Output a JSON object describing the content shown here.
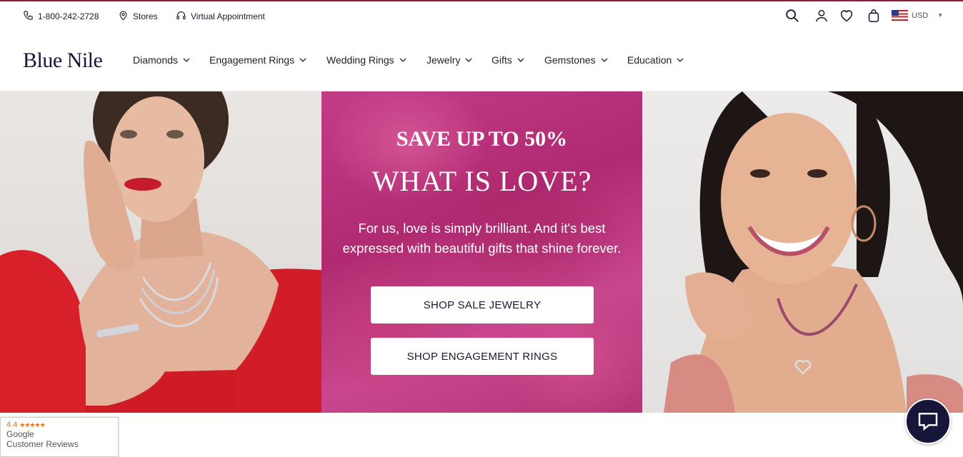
{
  "utility_bar": {
    "phone": "1-800-242-2728",
    "stores": "Stores",
    "virtual": "Virtual Appointment",
    "currency": "USD"
  },
  "nav": {
    "logo": "Blue Nile",
    "items": [
      {
        "label": "Diamonds"
      },
      {
        "label": "Engagement Rings"
      },
      {
        "label": "Wedding Rings"
      },
      {
        "label": "Jewelry"
      },
      {
        "label": "Gifts"
      },
      {
        "label": "Gemstones"
      },
      {
        "label": "Education"
      }
    ]
  },
  "hero": {
    "eyebrow": "SAVE UP TO 50%",
    "title": "WHAT IS LOVE?",
    "copy": "For us, love is simply brilliant. And it's best expressed with beautiful gifts that shine forever.",
    "button_primary": "SHOP SALE JEWELRY",
    "button_secondary": "SHOP ENGAGEMENT RINGS"
  },
  "reviews_badge": {
    "rating": "4.4",
    "line1": "Google",
    "line2": "Customer Reviews"
  },
  "colors": {
    "brand_navy": "#15163a",
    "hero_pink": "#c23d86",
    "top_rule": "#8a1f3a"
  }
}
